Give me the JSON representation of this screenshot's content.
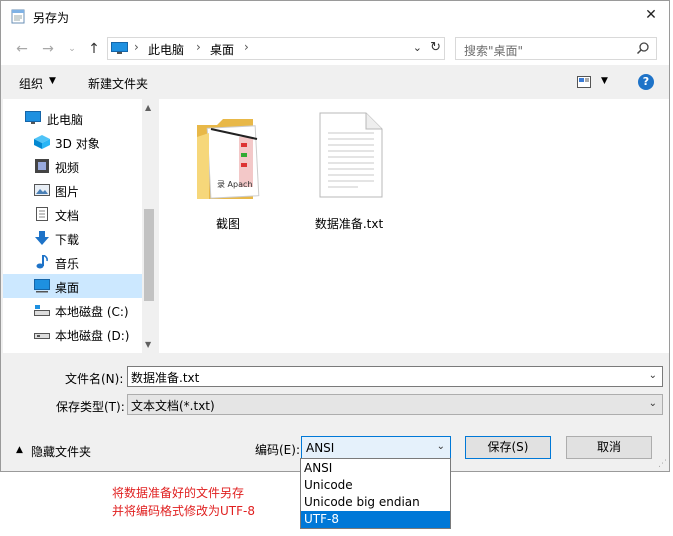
{
  "window": {
    "title": "另存为",
    "close": "✕"
  },
  "address": {
    "crumbs": [
      "此电脑",
      "桌面"
    ],
    "search_placeholder": "搜索\"桌面\""
  },
  "toolbar": {
    "organize": "组织",
    "new_folder": "新建文件夹",
    "help": "?"
  },
  "nav": {
    "items": [
      {
        "label": "此电脑",
        "icon": "pc-icon"
      },
      {
        "label": "3D 对象",
        "icon": "3d-objects-icon"
      },
      {
        "label": "视频",
        "icon": "video-icon"
      },
      {
        "label": "图片",
        "icon": "pictures-icon"
      },
      {
        "label": "文档",
        "icon": "documents-icon"
      },
      {
        "label": "下载",
        "icon": "download-icon"
      },
      {
        "label": "音乐",
        "icon": "music-icon"
      },
      {
        "label": "桌面",
        "icon": "desktop-icon",
        "selected": true
      },
      {
        "label": "本地磁盘 (C:)",
        "icon": "drive-icon"
      },
      {
        "label": "本地磁盘 (D:)",
        "icon": "drive-icon"
      }
    ]
  },
  "files": [
    {
      "name": "截图",
      "type": "folder",
      "thumb_text": "录 Apach"
    },
    {
      "name": "数据准备.txt",
      "type": "text-file"
    }
  ],
  "form": {
    "filename_label": "文件名(N):",
    "filename_value": "数据准备.txt",
    "filetype_label": "保存类型(T):",
    "filetype_value": "文本文档(*.txt)",
    "hide_folders": "隐藏文件夹",
    "encoding_label": "编码(E):",
    "encoding_value": "ANSI",
    "save": "保存(S)",
    "cancel": "取消"
  },
  "encoding_options": [
    "ANSI",
    "Unicode",
    "Unicode big endian",
    "UTF-8"
  ],
  "encoding_highlighted": "UTF-8",
  "annotation": {
    "line1": "将数据准备好的文件另存",
    "line2": "并将编码格式修改为UTF-8"
  },
  "colors": {
    "selection": "#cce8ff",
    "accent": "#0078d7",
    "annotation": "#e02020"
  }
}
